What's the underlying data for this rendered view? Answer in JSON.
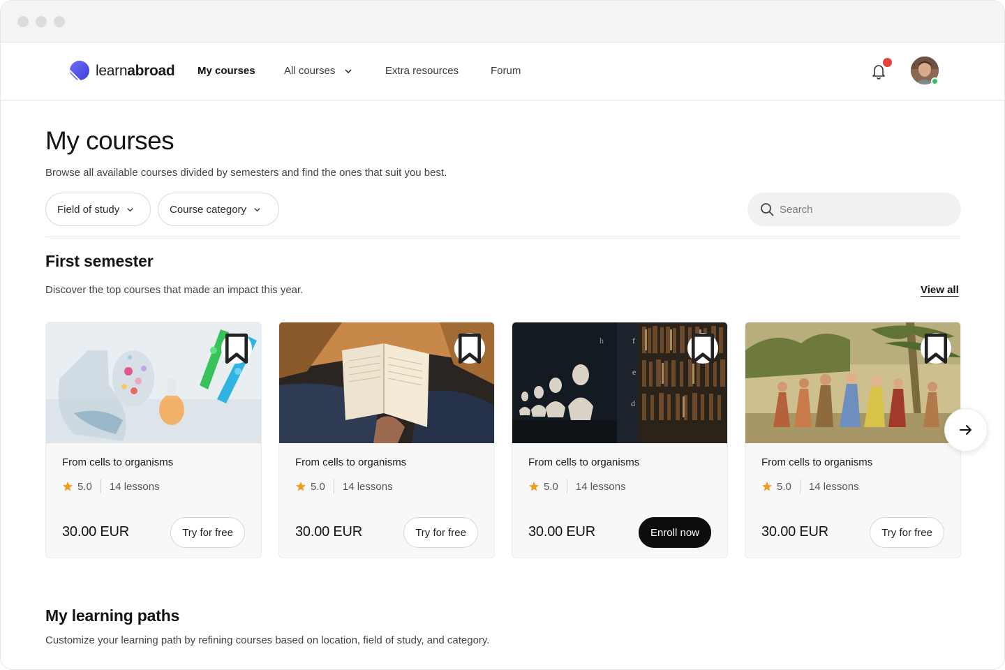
{
  "brand": {
    "name_light": "learn",
    "name_bold": "abroad",
    "accent": "#4a4fe6"
  },
  "nav": {
    "items": [
      {
        "label": "My courses",
        "active": true
      },
      {
        "label": "All courses",
        "has_dropdown": true
      },
      {
        "label": "Extra resources"
      },
      {
        "label": "Forum"
      }
    ],
    "notifications_icon": "bell-icon",
    "notification_badge_color": "#e8413b",
    "online_status_color": "#2fc05a"
  },
  "header": {
    "title": "My courses",
    "subtitle": "Browse all available courses divided by semesters and find the ones that suit you best."
  },
  "filters": [
    {
      "label": "Field of study"
    },
    {
      "label": "Course category"
    }
  ],
  "search": {
    "placeholder": "Search",
    "value": ""
  },
  "first_semester": {
    "title": "First semester",
    "subtitle": "Discover the top courses that made an impact this year.",
    "view_all_label": "View all",
    "courses": [
      {
        "image": "lab-flasks-photo",
        "title": "From cells to organisms",
        "rating": "5.0",
        "lessons": "14 lessons",
        "price": "30.00 EUR",
        "button": "Try for free",
        "button_style": "outline"
      },
      {
        "image": "open-book-photo",
        "title": "From cells to organisms",
        "rating": "5.0",
        "lessons": "14 lessons",
        "price": "30.00 EUR",
        "button": "Try for free",
        "button_style": "outline"
      },
      {
        "image": "library-busts-photo",
        "title": "From cells to organisms",
        "rating": "5.0",
        "lessons": "14 lessons",
        "price": "30.00 EUR",
        "button": "Enroll now",
        "button_style": "solid"
      },
      {
        "image": "historical-engraving-photo",
        "title": "From cells to organisms",
        "rating": "5.0",
        "lessons": "14 lessons",
        "price": "30.00 EUR",
        "button": "Try for free",
        "button_style": "outline"
      }
    ]
  },
  "learning_paths": {
    "title": "My learning paths",
    "subtitle": "Customize your learning path by refining courses based on location, field of study, and category."
  }
}
